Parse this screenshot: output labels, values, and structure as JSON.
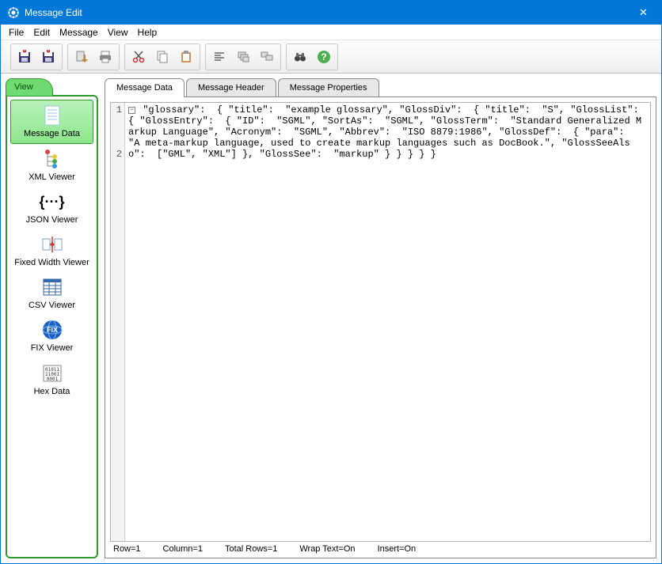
{
  "window": {
    "title": "Message Edit",
    "close_glyph": "✕"
  },
  "menu": {
    "file": "File",
    "edit": "Edit",
    "message": "Message",
    "view": "View",
    "help": "Help"
  },
  "toolbar_icons": {
    "save1": "save-disk-icon",
    "save2": "save-disk-icon",
    "export": "arrow-down-icon",
    "print": "printer-icon",
    "cut": "scissors-icon",
    "copy": "copy-icon",
    "paste": "clipboard-icon",
    "find_next": "align-left-icon",
    "collapse": "stack-icon",
    "expand": "stack-open-icon",
    "find": "binoculars-icon",
    "help": "help-icon"
  },
  "sidebar": {
    "tab_label": "View",
    "items": {
      "message_data": "Message Data",
      "xml_viewer": "XML Viewer",
      "json_viewer": "JSON Viewer",
      "fixed_width": "Fixed Width Viewer",
      "csv_viewer": "CSV Viewer",
      "fix_viewer": "FIX Viewer",
      "hex_data": "Hex Data"
    }
  },
  "tabs": {
    "data": "Message Data",
    "header": "Message Header",
    "properties": "Message Properties"
  },
  "editor": {
    "line1": "1",
    "line2": "2",
    "collapse_glyph": "−",
    "text": " \"glossary\":  { \"title\":  \"example glossary\", \"GlossDiv\":  { \"title\":  \"S\", \"GlossList\":  { \"GlossEntry\":  { \"ID\":  \"SGML\", \"SortAs\":  \"SGML\", \"GlossTerm\":  \"Standard Generalized Markup Language\", \"Acronym\":  \"SGML\", \"Abbrev\":  \"ISO 8879:1986\", \"GlossDef\":  { \"para\":  \"A meta-markup language, used to create markup languages such as DocBook.\", \"GlossSeeAlso\":  [\"GML\", \"XML\"] }, \"GlossSee\":  \"markup\" } } } } }"
  },
  "status": {
    "row": "Row=1",
    "column": "Column=1",
    "total_rows": "Total Rows=1",
    "wrap": "Wrap Text=On",
    "insert": "Insert=On"
  }
}
